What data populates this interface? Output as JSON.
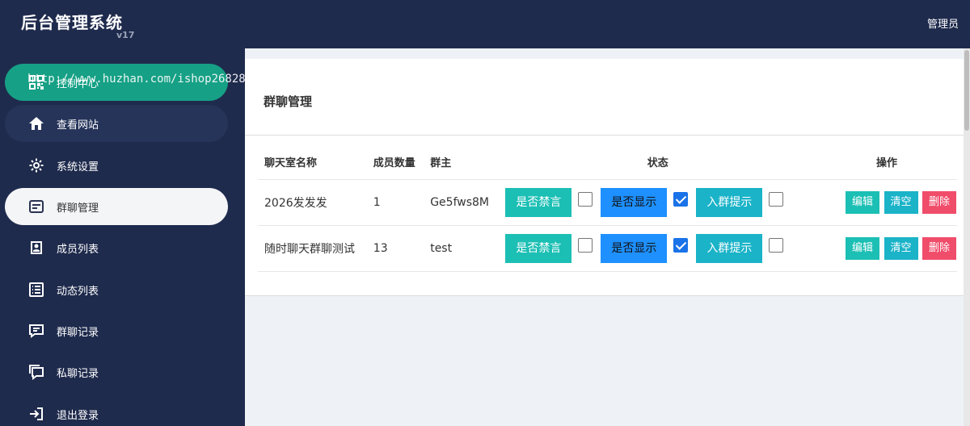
{
  "app": {
    "title": "后台管理系统",
    "version": "v17",
    "user": "管理员"
  },
  "watermark": "http://www.huzhan.com/ishop26828",
  "sidebar": {
    "items": [
      {
        "label": "控制中心",
        "icon": "qrcode-icon"
      },
      {
        "label": "查看网站",
        "icon": "home-icon"
      },
      {
        "label": "系统设置",
        "icon": "gear-icon"
      },
      {
        "label": "群聊管理",
        "icon": "list-card-icon"
      },
      {
        "label": "成员列表",
        "icon": "contact-card-icon"
      },
      {
        "label": "动态列表",
        "icon": "list-icon"
      },
      {
        "label": "群聊记录",
        "icon": "chat-icon"
      },
      {
        "label": "私聊记录",
        "icon": "chat-bubble-icon"
      },
      {
        "label": "退出登录",
        "icon": "logout-icon"
      }
    ]
  },
  "page": {
    "title": "群聊管理"
  },
  "table": {
    "headers": {
      "name": "聊天室名称",
      "count": "成员数量",
      "owner": "群主",
      "status": "状态",
      "actions": "操作"
    },
    "rows": [
      {
        "name": "2026发发发",
        "count": "1",
        "owner": "Ge5fws8M",
        "mute": "是否禁言",
        "mute_checked": false,
        "show": "是否显示",
        "show_checked": true,
        "notice": "入群提示",
        "notice_checked": false
      },
      {
        "name": "随时聊天群聊测试",
        "count": "13",
        "owner": "test",
        "mute": "是否禁言",
        "mute_checked": false,
        "show": "是否显示",
        "show_checked": true,
        "notice": "入群提示",
        "notice_checked": false
      }
    ],
    "action_labels": {
      "edit": "编辑",
      "clear": "清空",
      "delete": "删除"
    }
  },
  "colors": {
    "sidebar": "#1f2b4d",
    "accent_green": "#16a085",
    "teal": "#1cbfb4",
    "blue": "#1e90ff",
    "red": "#f04d6b"
  }
}
